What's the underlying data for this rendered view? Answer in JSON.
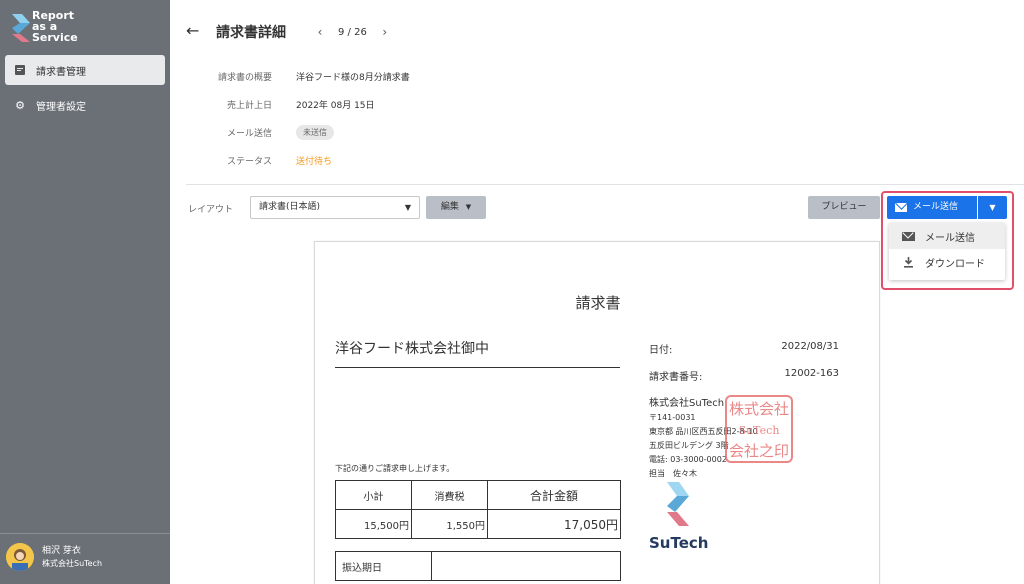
{
  "app": {
    "logo_line1": "Report",
    "logo_line2": "as a",
    "logo_line3": "Service"
  },
  "sidebar": {
    "items": [
      {
        "label": "請求書管理",
        "icon": "document-icon",
        "active": true
      },
      {
        "label": "管理者設定",
        "icon": "gear-icon",
        "active": false
      }
    ],
    "user": {
      "name": "相沢 芽衣",
      "company": "株式会社SuTech"
    }
  },
  "header": {
    "title": "請求書詳細",
    "pager": "9 / 26",
    "back": "←",
    "prev": "‹",
    "next": "›"
  },
  "info": [
    {
      "label": "請求書の概要",
      "value": "洋谷フード様の8月分請求書"
    },
    {
      "label": "売上計上日",
      "value": "2022年 08月 15日"
    },
    {
      "label": "メール送信",
      "value": "未送信"
    },
    {
      "label": "ステータス",
      "value": "送付待ち"
    }
  ],
  "toolbar": {
    "layout_label": "レイアウト",
    "layout_value": "請求書(日本語)",
    "edit_label": "編集",
    "preview_label": "プレビュー",
    "mail_label": "メール送信",
    "menu": [
      {
        "label": "メール送信",
        "icon": "envelope-icon"
      },
      {
        "label": "ダウンロード",
        "icon": "download-icon"
      }
    ]
  },
  "document": {
    "title": "請求書",
    "recipient": "洋谷フード株式会社御中",
    "date_label": "日付:",
    "date_value": "2022/08/31",
    "number_label": "請求書番号:",
    "number_value": "12002-163",
    "company_name": "株式会社SuTech",
    "postal": "〒141-0031",
    "address1": "東京都 品川区西五反田2-8-10",
    "address2": "五反田ビルデング 3階",
    "phone": "電話: 03-3000-0002",
    "contact": "担当　佐々木",
    "seal_line1": "株式会社",
    "seal_line2": "SuTech",
    "seal_line3": "会社之印",
    "logo_text": "SuTech",
    "notice": "下記の通りご請求申し上げます。",
    "summary_headers": [
      "小計",
      "消費税",
      "合計金額"
    ],
    "summary_values": [
      "15,500円",
      "1,550円",
      "17,050円"
    ],
    "due_label": "振込期日"
  },
  "colors": {
    "sidebar": "#6b7077",
    "primary": "#1a73e8",
    "status": "#f59a23",
    "highlight": "#e0506b",
    "seal": "#e66a6a"
  }
}
